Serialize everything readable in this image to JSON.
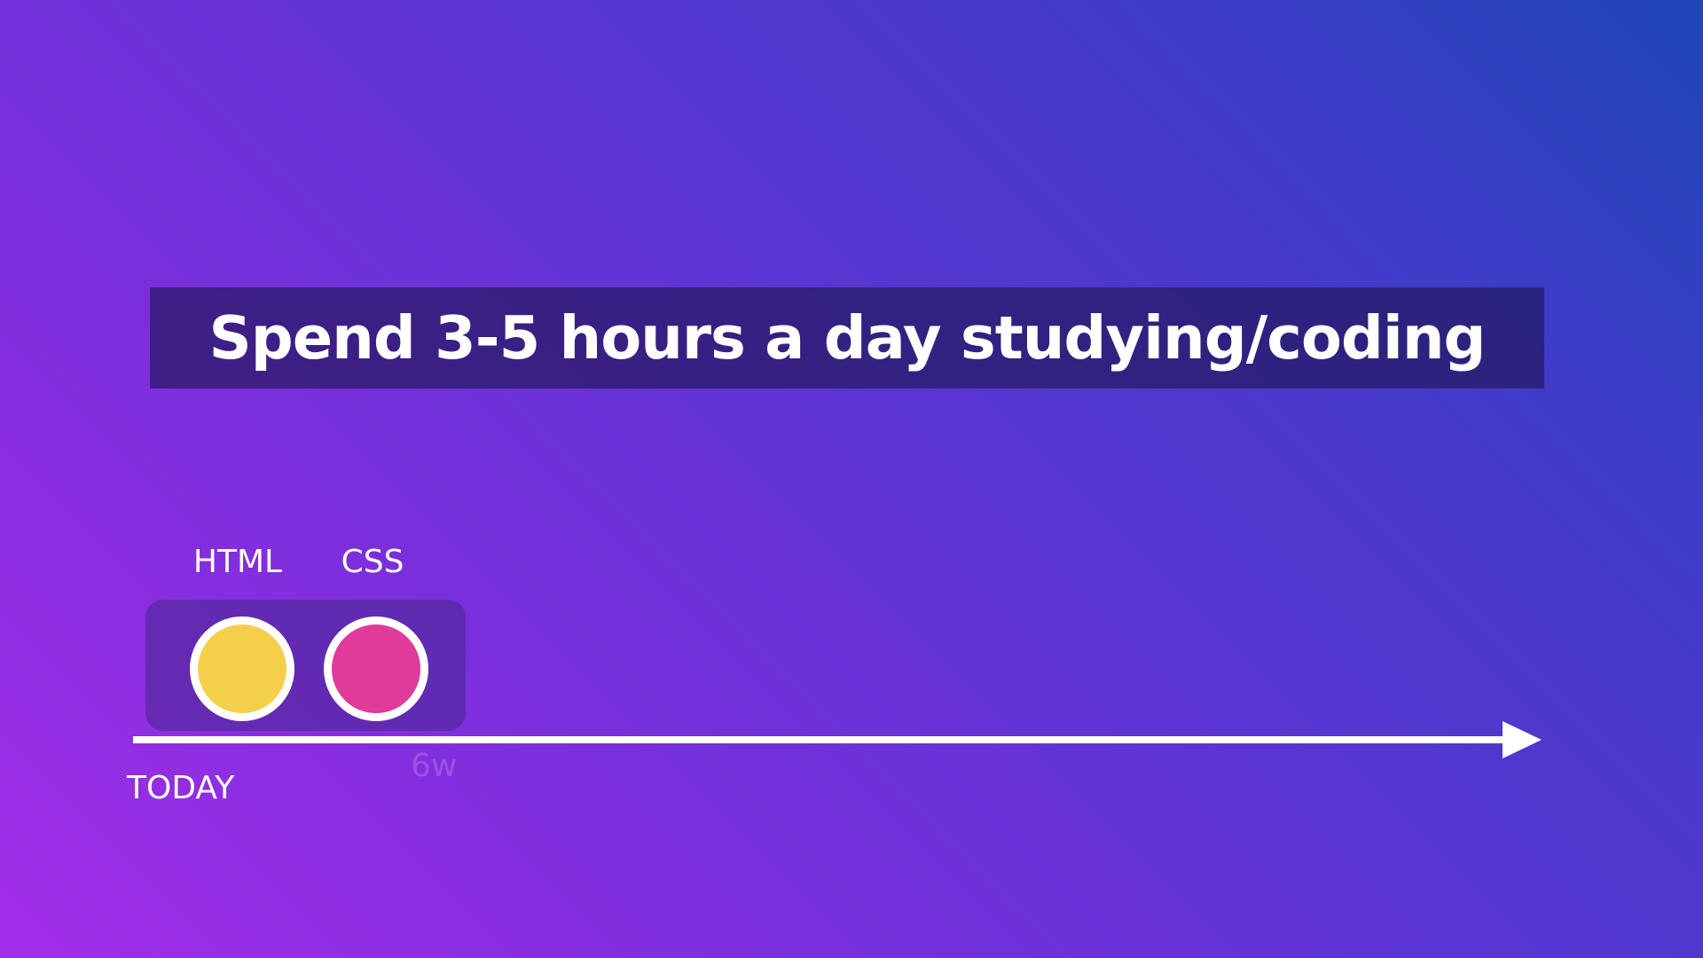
{
  "title": "Spend 3-5 hours a day studying/coding",
  "timeline": {
    "start_label": "TODAY",
    "marker_label": "6w",
    "skills": [
      {
        "label": "HTML",
        "color": "#f4d04a"
      },
      {
        "label": "CSS",
        "color": "#e03a9a"
      }
    ]
  }
}
